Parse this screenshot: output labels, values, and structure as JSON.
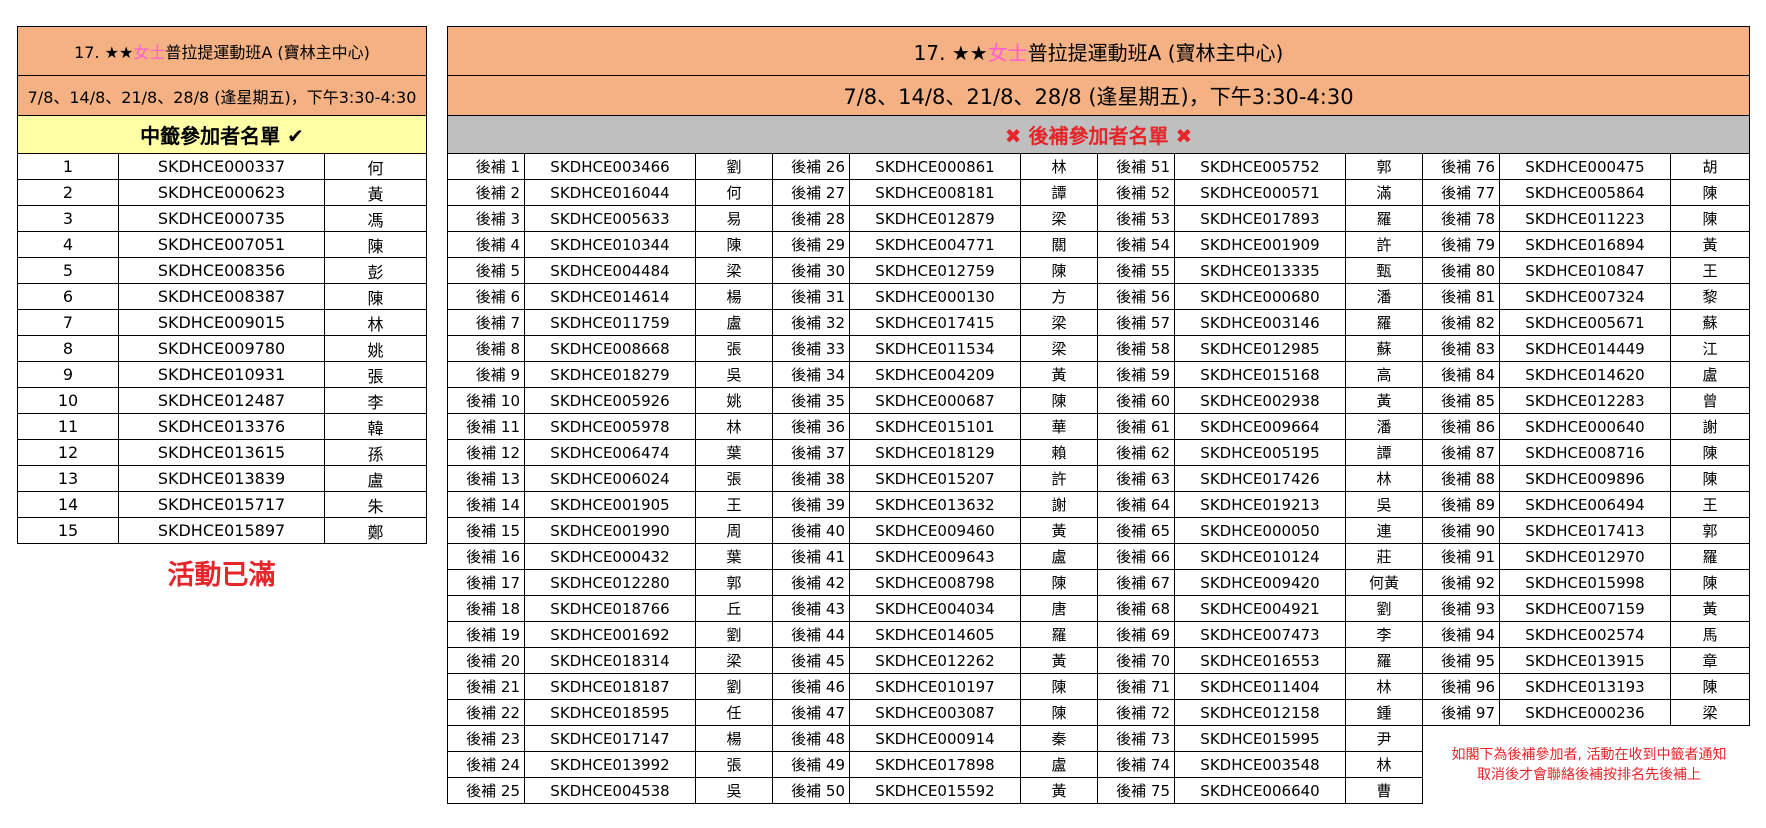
{
  "title_prefix": "17. ★★",
  "title_highlight": "女士",
  "title_suffix": "普拉提運動班A (寶林主中心)",
  "date_line": "7/8、14/8、21/8、28/8 (逢星期五)，下午3:30-4:30",
  "winners": {
    "heading": "中籤參加者名單",
    "check_glyph": "✔",
    "rows": [
      {
        "no": "1",
        "id": "SKDHCE000337",
        "name": "何"
      },
      {
        "no": "2",
        "id": "SKDHCE000623",
        "name": "黃"
      },
      {
        "no": "3",
        "id": "SKDHCE000735",
        "name": "馮"
      },
      {
        "no": "4",
        "id": "SKDHCE007051",
        "name": "陳"
      },
      {
        "no": "5",
        "id": "SKDHCE008356",
        "name": "彭"
      },
      {
        "no": "6",
        "id": "SKDHCE008387",
        "name": "陳"
      },
      {
        "no": "7",
        "id": "SKDHCE009015",
        "name": "林"
      },
      {
        "no": "8",
        "id": "SKDHCE009780",
        "name": "姚"
      },
      {
        "no": "9",
        "id": "SKDHCE010931",
        "name": "張"
      },
      {
        "no": "10",
        "id": "SKDHCE012487",
        "name": "李"
      },
      {
        "no": "11",
        "id": "SKDHCE013376",
        "name": "韓"
      },
      {
        "no": "12",
        "id": "SKDHCE013615",
        "name": "孫"
      },
      {
        "no": "13",
        "id": "SKDHCE013839",
        "name": "盧"
      },
      {
        "no": "14",
        "id": "SKDHCE015717",
        "name": "朱"
      },
      {
        "no": "15",
        "id": "SKDHCE015897",
        "name": "鄭"
      }
    ],
    "full_text": "活動已滿"
  },
  "waitlist": {
    "heading": "後補參加者名單",
    "x_glyph": "✖",
    "entries": [
      {
        "label": "後補 1",
        "id": "SKDHCE003466",
        "name": "劉"
      },
      {
        "label": "後補 2",
        "id": "SKDHCE016044",
        "name": "何"
      },
      {
        "label": "後補 3",
        "id": "SKDHCE005633",
        "name": "易"
      },
      {
        "label": "後補 4",
        "id": "SKDHCE010344",
        "name": "陳"
      },
      {
        "label": "後補 5",
        "id": "SKDHCE004484",
        "name": "梁"
      },
      {
        "label": "後補 6",
        "id": "SKDHCE014614",
        "name": "楊"
      },
      {
        "label": "後補 7",
        "id": "SKDHCE011759",
        "name": "盧"
      },
      {
        "label": "後補 8",
        "id": "SKDHCE008668",
        "name": "張"
      },
      {
        "label": "後補 9",
        "id": "SKDHCE018279",
        "name": "吳"
      },
      {
        "label": "後補 10",
        "id": "SKDHCE005926",
        "name": "姚"
      },
      {
        "label": "後補 11",
        "id": "SKDHCE005978",
        "name": "林"
      },
      {
        "label": "後補 12",
        "id": "SKDHCE006474",
        "name": "葉"
      },
      {
        "label": "後補 13",
        "id": "SKDHCE006024",
        "name": "張"
      },
      {
        "label": "後補 14",
        "id": "SKDHCE001905",
        "name": "王"
      },
      {
        "label": "後補 15",
        "id": "SKDHCE001990",
        "name": "周"
      },
      {
        "label": "後補 16",
        "id": "SKDHCE000432",
        "name": "葉"
      },
      {
        "label": "後補 17",
        "id": "SKDHCE012280",
        "name": "郭"
      },
      {
        "label": "後補 18",
        "id": "SKDHCE018766",
        "name": "丘"
      },
      {
        "label": "後補 19",
        "id": "SKDHCE001692",
        "name": "劉"
      },
      {
        "label": "後補 20",
        "id": "SKDHCE018314",
        "name": "梁"
      },
      {
        "label": "後補 21",
        "id": "SKDHCE018187",
        "name": "劉"
      },
      {
        "label": "後補 22",
        "id": "SKDHCE018595",
        "name": "任"
      },
      {
        "label": "後補 23",
        "id": "SKDHCE017147",
        "name": "楊"
      },
      {
        "label": "後補 24",
        "id": "SKDHCE013992",
        "name": "張"
      },
      {
        "label": "後補 25",
        "id": "SKDHCE004538",
        "name": "吳"
      },
      {
        "label": "後補 26",
        "id": "SKDHCE000861",
        "name": "林"
      },
      {
        "label": "後補 27",
        "id": "SKDHCE008181",
        "name": "譚"
      },
      {
        "label": "後補 28",
        "id": "SKDHCE012879",
        "name": "梁"
      },
      {
        "label": "後補 29",
        "id": "SKDHCE004771",
        "name": "關"
      },
      {
        "label": "後補 30",
        "id": "SKDHCE012759",
        "name": "陳"
      },
      {
        "label": "後補 31",
        "id": "SKDHCE000130",
        "name": "方"
      },
      {
        "label": "後補 32",
        "id": "SKDHCE017415",
        "name": "梁"
      },
      {
        "label": "後補 33",
        "id": "SKDHCE011534",
        "name": "梁"
      },
      {
        "label": "後補 34",
        "id": "SKDHCE004209",
        "name": "黃"
      },
      {
        "label": "後補 35",
        "id": "SKDHCE000687",
        "name": "陳"
      },
      {
        "label": "後補 36",
        "id": "SKDHCE015101",
        "name": "華"
      },
      {
        "label": "後補 37",
        "id": "SKDHCE018129",
        "name": "賴"
      },
      {
        "label": "後補 38",
        "id": "SKDHCE015207",
        "name": "許"
      },
      {
        "label": "後補 39",
        "id": "SKDHCE013632",
        "name": "謝"
      },
      {
        "label": "後補 40",
        "id": "SKDHCE009460",
        "name": "黃"
      },
      {
        "label": "後補 41",
        "id": "SKDHCE009643",
        "name": "盧"
      },
      {
        "label": "後補 42",
        "id": "SKDHCE008798",
        "name": "陳"
      },
      {
        "label": "後補 43",
        "id": "SKDHCE004034",
        "name": "唐"
      },
      {
        "label": "後補 44",
        "id": "SKDHCE014605",
        "name": "羅"
      },
      {
        "label": "後補 45",
        "id": "SKDHCE012262",
        "name": "黃"
      },
      {
        "label": "後補 46",
        "id": "SKDHCE010197",
        "name": "陳"
      },
      {
        "label": "後補 47",
        "id": "SKDHCE003087",
        "name": "陳"
      },
      {
        "label": "後補 48",
        "id": "SKDHCE000914",
        "name": "秦"
      },
      {
        "label": "後補 49",
        "id": "SKDHCE017898",
        "name": "盧"
      },
      {
        "label": "後補 50",
        "id": "SKDHCE015592",
        "name": "黃"
      },
      {
        "label": "後補 51",
        "id": "SKDHCE005752",
        "name": "郭"
      },
      {
        "label": "後補 52",
        "id": "SKDHCE000571",
        "name": "滿"
      },
      {
        "label": "後補 53",
        "id": "SKDHCE017893",
        "name": "羅"
      },
      {
        "label": "後補 54",
        "id": "SKDHCE001909",
        "name": "許"
      },
      {
        "label": "後補 55",
        "id": "SKDHCE013335",
        "name": "甄"
      },
      {
        "label": "後補 56",
        "id": "SKDHCE000680",
        "name": "潘"
      },
      {
        "label": "後補 57",
        "id": "SKDHCE003146",
        "name": "羅"
      },
      {
        "label": "後補 58",
        "id": "SKDHCE012985",
        "name": "蘇"
      },
      {
        "label": "後補 59",
        "id": "SKDHCE015168",
        "name": "高"
      },
      {
        "label": "後補 60",
        "id": "SKDHCE002938",
        "name": "黃"
      },
      {
        "label": "後補 61",
        "id": "SKDHCE009664",
        "name": "潘"
      },
      {
        "label": "後補 62",
        "id": "SKDHCE005195",
        "name": "譚"
      },
      {
        "label": "後補 63",
        "id": "SKDHCE017426",
        "name": "林"
      },
      {
        "label": "後補 64",
        "id": "SKDHCE019213",
        "name": "吳"
      },
      {
        "label": "後補 65",
        "id": "SKDHCE000050",
        "name": "連"
      },
      {
        "label": "後補 66",
        "id": "SKDHCE010124",
        "name": "莊"
      },
      {
        "label": "後補 67",
        "id": "SKDHCE009420",
        "name": "何黃"
      },
      {
        "label": "後補 68",
        "id": "SKDHCE004921",
        "name": "劉"
      },
      {
        "label": "後補 69",
        "id": "SKDHCE007473",
        "name": "李"
      },
      {
        "label": "後補 70",
        "id": "SKDHCE016553",
        "name": "羅"
      },
      {
        "label": "後補 71",
        "id": "SKDHCE011404",
        "name": "林"
      },
      {
        "label": "後補 72",
        "id": "SKDHCE012158",
        "name": "鍾"
      },
      {
        "label": "後補 73",
        "id": "SKDHCE015995",
        "name": "尹"
      },
      {
        "label": "後補 74",
        "id": "SKDHCE003548",
        "name": "林"
      },
      {
        "label": "後補 75",
        "id": "SKDHCE006640",
        "name": "曹"
      },
      {
        "label": "後補 76",
        "id": "SKDHCE000475",
        "name": "胡"
      },
      {
        "label": "後補 77",
        "id": "SKDHCE005864",
        "name": "陳"
      },
      {
        "label": "後補 78",
        "id": "SKDHCE011223",
        "name": "陳"
      },
      {
        "label": "後補 79",
        "id": "SKDHCE016894",
        "name": "黃"
      },
      {
        "label": "後補 80",
        "id": "SKDHCE010847",
        "name": "王"
      },
      {
        "label": "後補 81",
        "id": "SKDHCE007324",
        "name": "黎"
      },
      {
        "label": "後補 82",
        "id": "SKDHCE005671",
        "name": "蘇"
      },
      {
        "label": "後補 83",
        "id": "SKDHCE014449",
        "name": "江"
      },
      {
        "label": "後補 84",
        "id": "SKDHCE014620",
        "name": "盧"
      },
      {
        "label": "後補 85",
        "id": "SKDHCE012283",
        "name": "曾"
      },
      {
        "label": "後補 86",
        "id": "SKDHCE000640",
        "name": "謝"
      },
      {
        "label": "後補 87",
        "id": "SKDHCE008716",
        "name": "陳"
      },
      {
        "label": "後補 88",
        "id": "SKDHCE009896",
        "name": "陳"
      },
      {
        "label": "後補 89",
        "id": "SKDHCE006494",
        "name": "王"
      },
      {
        "label": "後補 90",
        "id": "SKDHCE017413",
        "name": "郭"
      },
      {
        "label": "後補 91",
        "id": "SKDHCE012970",
        "name": "羅"
      },
      {
        "label": "後補 92",
        "id": "SKDHCE015998",
        "name": "陳"
      },
      {
        "label": "後補 93",
        "id": "SKDHCE007159",
        "name": "黃"
      },
      {
        "label": "後補 94",
        "id": "SKDHCE002574",
        "name": "馬"
      },
      {
        "label": "後補 95",
        "id": "SKDHCE013915",
        "name": "章"
      },
      {
        "label": "後補 96",
        "id": "SKDHCE013193",
        "name": "陳"
      },
      {
        "label": "後補 97",
        "id": "SKDHCE000236",
        "name": "梁"
      }
    ],
    "note_line1": "如閣下為後補參加者, 活動在收到中籤者通知",
    "note_line2": "取消後才會聯絡後補按排名先後補上"
  },
  "colors": {
    "header_bg": "#f4b183",
    "winners_heading_bg": "#ffffa6",
    "waitlist_heading_bg": "#bfbfbf",
    "red_text": "#e5252a",
    "pink_text": "#ff5fd0"
  }
}
